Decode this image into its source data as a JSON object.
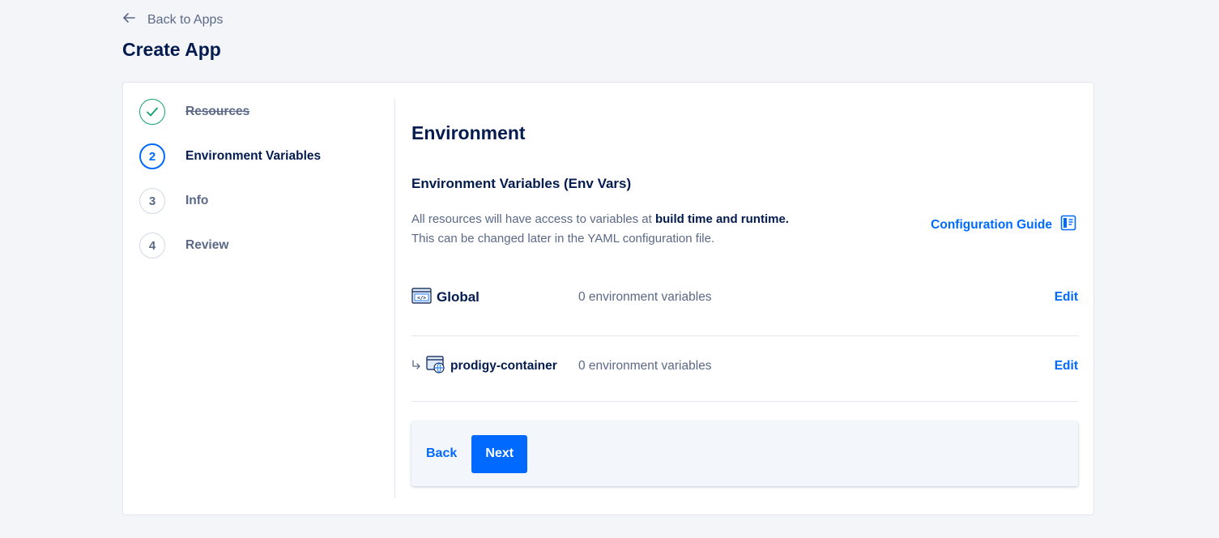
{
  "nav": {
    "back_label": "Back to Apps"
  },
  "page": {
    "title": "Create App"
  },
  "steps": [
    {
      "number": "",
      "label": "Resources",
      "state": "done"
    },
    {
      "number": "2",
      "label": "Environment Variables",
      "state": "active"
    },
    {
      "number": "3",
      "label": "Info",
      "state": "pending"
    },
    {
      "number": "4",
      "label": "Review",
      "state": "pending"
    }
  ],
  "environment": {
    "title": "Environment",
    "subtitle": "Environment Variables (Env Vars)",
    "desc_prefix": "All resources will have access to variables at ",
    "desc_bold": "build time and runtime.",
    "desc_line2": "This can be changed later in the YAML configuration file.",
    "guide_label": "Configuration Guide",
    "rows": [
      {
        "name": "Global",
        "count": "0 environment variables",
        "edit": "Edit",
        "icon": "code-window-icon"
      },
      {
        "name": "prodigy-container",
        "count": "0 environment variables",
        "edit": "Edit",
        "icon": "web-container-icon"
      }
    ]
  },
  "footer": {
    "back_label": "Back",
    "next_label": "Next"
  },
  "colors": {
    "accent": "#0069ff",
    "success": "#15a06b",
    "heading": "#031b4e",
    "muted": "#5b6987"
  }
}
